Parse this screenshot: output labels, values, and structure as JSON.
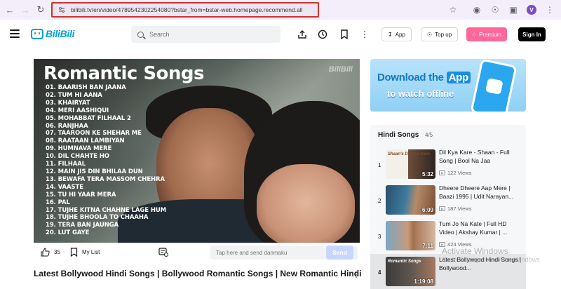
{
  "browser": {
    "url": "bilibili.tv/en/video/4789542302254080?bstar_from=bstar-web.homepage.recommend.all",
    "profile_initial": "V"
  },
  "header": {
    "logo_text": "BiliBili",
    "search_placeholder": "Search",
    "app_label": "App",
    "top_up_label": "Top up",
    "premium_label": "Premium",
    "sign_in_label": "Sign In"
  },
  "video": {
    "overlay_title": "Romantic Songs",
    "watermark": "BiliBili",
    "songs": [
      "01. BAARISH BAN JAANA",
      "02. TUM HI AANA",
      "03. KHAIRYAT",
      "04. MERI AASHIQUI",
      "05. MOHABBAT FILHAAL 2",
      "06. RANJHAA",
      "07. TAAROON KE SHEHAR ME",
      "08. RAATAAN LAMBIYAN",
      "09. HUMNAVA MERE",
      "10. DIL CHAHTE HO",
      "11. FILHAAL",
      "12. MAIN JIS DIN BHILAA DUN",
      "13. BEWAFA TERA MASSOM CHEHRA",
      "14. VAASTE",
      "15. TU HI YAAR MERA",
      "16. PAL",
      "17. TUJHE KITNA CHAHNE LAGE HUM",
      "18. TUJHE BHOOLA TO CHAAHA",
      "19. TERA BAN JAUNGA",
      "20. LUT GAYE"
    ],
    "likes": "35",
    "my_list_label": "My List",
    "danmaku_placeholder": "Tap here and send danmaku",
    "send_label": "Send",
    "headline": "Latest Bollywood Hindi Songs | Bollywood Romantic Songs | New Romantic Hindi"
  },
  "banner": {
    "line1_prefix": "Download the",
    "line1_highlight": "App",
    "line2": "to watch offline"
  },
  "hindi_songs": {
    "title": "Hindi Songs",
    "count": "4/5",
    "items": [
      {
        "index": "1",
        "title": "Dil Kya Kare - Shaan - Full Song | Bool Na Jaa",
        "views": "122 Views",
        "duration": "5:32",
        "thumb_text": "Shaan's Dil Kya Kare"
      },
      {
        "index": "2",
        "title": "Dheere Dheere Aap Mere | Baazi 1995 | Udit Narayan...",
        "views": "187 Views",
        "duration": "6:09",
        "thumb_text": ""
      },
      {
        "index": "3",
        "title": "Tum Jo Na Kate | Full HD Video | Akshay Kumar | ...",
        "views": "424 Views",
        "duration": "7:11",
        "thumb_text": ""
      },
      {
        "index": "4",
        "title": "Latest Bollywood Hindi Songs | Bollywood...",
        "views": "",
        "duration": "1:19:08",
        "thumb_text": "Romantic Songs"
      }
    ]
  },
  "os_watermark": {
    "line1": "Activate Windows",
    "line2": "Go to Settings to activate Windows"
  }
}
